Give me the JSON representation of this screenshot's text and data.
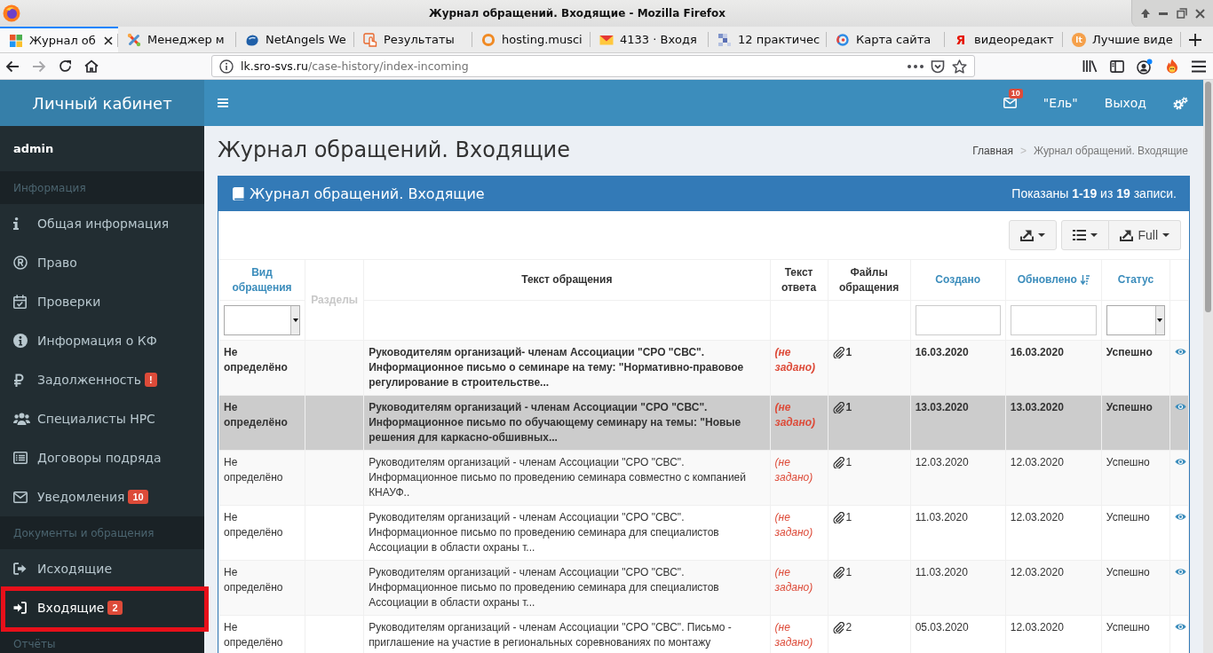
{
  "window": {
    "title": "Журнал обращений. Входящие - Mozilla Firefox"
  },
  "browser_tabs": [
    {
      "title": "Журнал об",
      "selected": true
    },
    {
      "title": "Менеджер м",
      "selected": false
    },
    {
      "title": "NetAngels We",
      "selected": false
    },
    {
      "title": "Результаты",
      "selected": false
    },
    {
      "title": "hosting.musci",
      "selected": false
    },
    {
      "title": "4133 · Входя",
      "selected": false
    },
    {
      "title": "12 практичес",
      "selected": false
    },
    {
      "title": "Карта сайта",
      "selected": false
    },
    {
      "title": "видеоредакт",
      "selected": false,
      "icon_letter": "Я"
    },
    {
      "title": "Лучшие виде",
      "selected": false,
      "icon_letter": "lt"
    }
  ],
  "address_bar": {
    "host": "lk.sro-svs.ru",
    "path": "/case-history/index-incoming"
  },
  "app": {
    "logo": "Личный кабинет",
    "user": "admin"
  },
  "navbar": {
    "notifications_badge": "10",
    "user": "\"Ель\"",
    "logout": "Выход"
  },
  "sidebar": {
    "sections": [
      {
        "header": "Информация",
        "items": [
          {
            "label": "Общая информация",
            "selected": false,
            "outlined": false
          },
          {
            "label": "Право",
            "selected": false,
            "outlined": false
          },
          {
            "label": "Проверки",
            "selected": false,
            "outlined": false
          },
          {
            "label": "Информация о КФ",
            "selected": false,
            "outlined": false
          },
          {
            "label": "Задолженность",
            "badge": "!",
            "selected": false,
            "outlined": false
          },
          {
            "label": "Специалисты НРС",
            "selected": false,
            "outlined": false
          },
          {
            "label": "Договоры подряда",
            "selected": false,
            "outlined": false
          },
          {
            "label": "Уведомления",
            "badge": "10",
            "selected": false,
            "outlined": false
          }
        ]
      },
      {
        "header": "Документы и обращения",
        "items": [
          {
            "label": "Исходящие",
            "selected": false,
            "outlined": false
          },
          {
            "label": "Входящие",
            "badge": "2",
            "selected": true,
            "outlined": true
          }
        ]
      },
      {
        "header": "Отчёты"
      }
    ]
  },
  "page": {
    "title": "Журнал обращений. Входящие",
    "breadcrumb": {
      "items": [
        "Главная",
        "Журнал обращений. Входящие"
      ],
      "separator": ">"
    }
  },
  "panel": {
    "title": "Журнал обращений. Входящие",
    "summary": "Показаны **1-19** из **19** записи.",
    "export_label": "Full"
  },
  "table": {
    "columns": [
      {
        "label": "Вид обращения",
        "kind": "link",
        "sorted": false,
        "filter": {
          "kind": "select"
        }
      },
      {
        "label": "Разделы",
        "kind": "muted",
        "sorted": false
      },
      {
        "label": "Текст обращения",
        "kind": "plain",
        "sorted": false
      },
      {
        "label": "Текст ответа",
        "kind": "plain",
        "sorted": false
      },
      {
        "label": "Файлы обращения",
        "kind": "plain",
        "sorted": false
      },
      {
        "label": "Создано",
        "kind": "link",
        "sorted": false,
        "filter": {
          "kind": "text"
        }
      },
      {
        "label": "Обновлено",
        "kind": "link",
        "sorted": true,
        "filter": {
          "kind": "text"
        }
      },
      {
        "label": "Статус",
        "kind": "link",
        "sorted": false,
        "filter": {
          "kind": "select"
        }
      }
    ],
    "rows": [
      {
        "type": "Не определёно",
        "text": "Руководителям организаций- членам Ассоциации \"СРО \"СВС\". Информационное письмо о семинаре на тему: \"Нормативно-правовое регулирование в строительстве...",
        "answer": "(не задано)",
        "files": "1",
        "created": "16.03.2020",
        "updated": "16.03.2020",
        "status": "Успешно",
        "unread": true,
        "selected": false
      },
      {
        "type": "Не определёно",
        "text": "Руководителям организаций - членам Ассоциации \"СРО \"СВС\". Информационное письмо по обучающему семинару на темы: \"Новые решения для каркасно-обшивных...",
        "answer": "(не задано)",
        "files": "1",
        "created": "13.03.2020",
        "updated": "13.03.2020",
        "status": "Успешно",
        "unread": true,
        "selected": true
      },
      {
        "type": "Не определёно",
        "text": "Руководителям организаций - членам Ассоциации \"СРО \"СВС\". Информационное письмо по проведению семинара совместно с компанией КНАУФ..",
        "answer": "(не задано)",
        "files": "1",
        "created": "12.03.2020",
        "updated": "12.03.2020",
        "status": "Успешно",
        "unread": false,
        "selected": false
      },
      {
        "type": "Не определёно",
        "text": "Руководителям организаций - членам Ассоциации \"СРО \"СВС\". Информационное письмо по проведению семинара для специалистов Ассоциации в области охраны т...",
        "answer": "(не задано)",
        "files": "1",
        "created": "11.03.2020",
        "updated": "12.03.2020",
        "status": "Успешно",
        "unread": false,
        "selected": false
      },
      {
        "type": "Не определёно",
        "text": "Руководителям организаций - членам Ассоциации \"СРО \"СВС\". Информационное письмо по проведению семинара для специалистов Ассоциации в области охраны т...",
        "answer": "(не задано)",
        "files": "1",
        "created": "11.03.2020",
        "updated": "12.03.2020",
        "status": "Успешно",
        "unread": false,
        "selected": false
      },
      {
        "type": "Не определёно",
        "text": "Руководителям организаций - членам Ассоциации \"СРО \"СВС\". Письмо - приглашение на участие в региональных соревнованиях по монтажу",
        "answer": "(не задано)",
        "files": "2",
        "created": "05.03.2020",
        "updated": "12.03.2020",
        "status": "Успешно",
        "unread": false,
        "selected": false
      }
    ]
  }
}
